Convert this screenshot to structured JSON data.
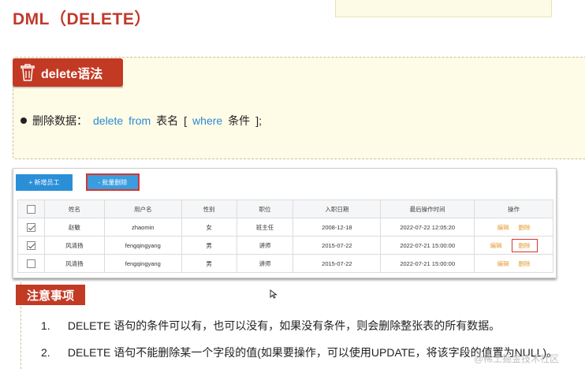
{
  "slide": {
    "title": "DML（DELETE）"
  },
  "syntax": {
    "tag_label": "delete语法",
    "line": {
      "prefix": "删除数据：",
      "kw_delete": "delete",
      "kw_from": "from",
      "table": "表名",
      "bracket_open": "[",
      "kw_where": "where",
      "cond": "条件",
      "bracket_close": "];"
    }
  },
  "toolbar": {
    "add_label": "+ 新增员工",
    "batch_delete_label": "- 批量删除"
  },
  "table": {
    "headers": [
      "",
      "姓名",
      "用户名",
      "性别",
      "职位",
      "入职日期",
      "最后操作时间",
      "操作"
    ],
    "rows": [
      {
        "checked": true,
        "name": "赵敏",
        "username": "zhaomin",
        "gender": "女",
        "job": "班主任",
        "entry_date": "2008-12-18",
        "update_time": "2022-07-22 12:05:20",
        "edit": "编辑",
        "delete": "删除"
      },
      {
        "checked": true,
        "name": "风清扬",
        "username": "fengqingyang",
        "gender": "男",
        "job": "讲师",
        "entry_date": "2015-07-22",
        "update_time": "2022-07-21 15:00:00",
        "edit": "编辑",
        "delete": "删除"
      },
      {
        "checked": false,
        "name": "风清扬",
        "username": "fengqingyang",
        "gender": "男",
        "job": "讲师",
        "entry_date": "2015-07-22",
        "update_time": "2022-07-21 15:00:00",
        "edit": "编辑",
        "delete": "删除"
      }
    ]
  },
  "notice": {
    "tag_label": "注意事项",
    "items": [
      {
        "num": "1.",
        "text": "DELETE 语句的条件可以有，也可以没有，如果没有条件，则会删除整张表的所有数据。"
      },
      {
        "num": "2.",
        "text": "DELETE 语句不能删除某一个字段的值(如果要操作，可以使用UPDATE，将该字段的值置为NULL)。"
      }
    ]
  },
  "watermark": "@稀土掘金技术社区",
  "colors": {
    "accent_red": "#c23a24",
    "keyword_blue": "#2a8bd0",
    "button_blue": "#2b8fd8",
    "op_orange": "#e59a2b"
  },
  "icons": {
    "syntax_tag": "trash-icon"
  }
}
